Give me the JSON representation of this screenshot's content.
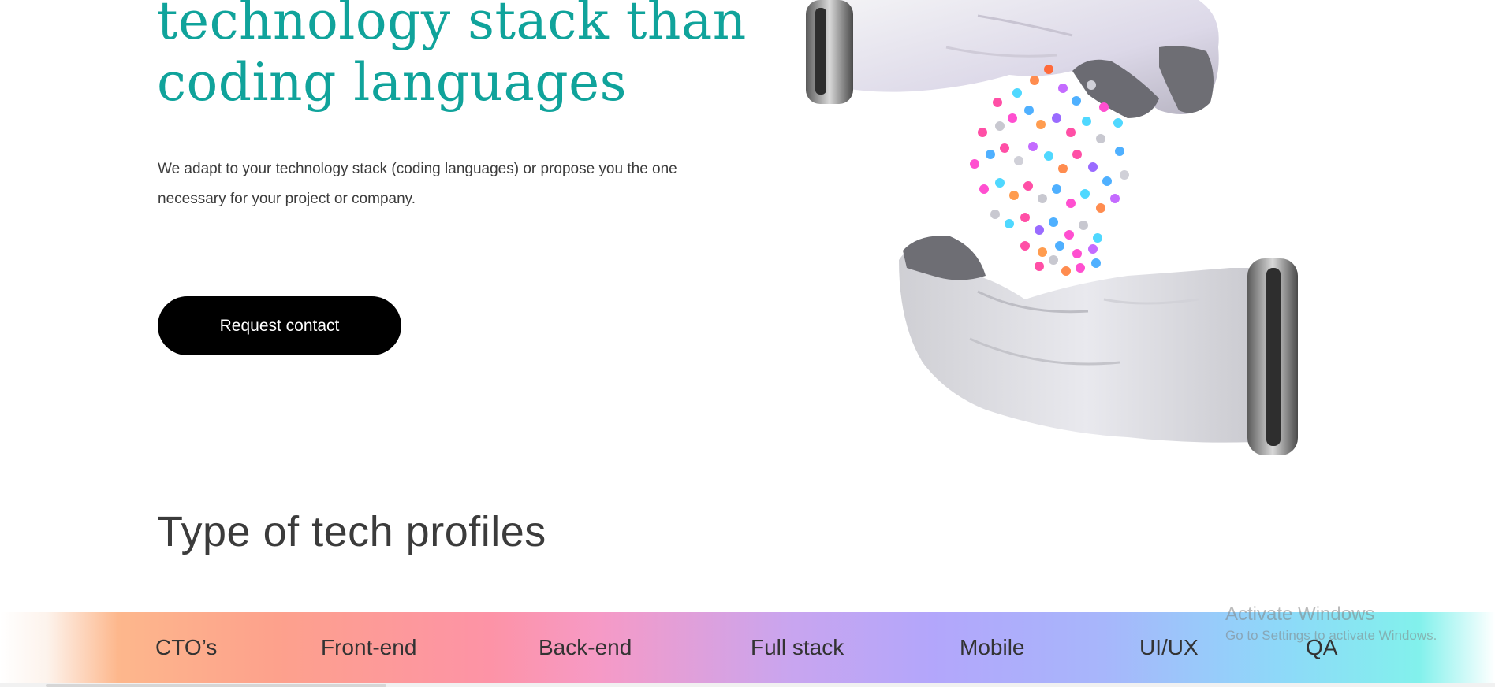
{
  "hero": {
    "title_line1": "technology stack than",
    "title_line2": "coding languages",
    "description": "We adapt to your technology stack (coding languages) or propose you the one necessary for your project or company.",
    "cta_label": "Request contact",
    "illustration": "astronaut-gloves-particles"
  },
  "profiles": {
    "title": "Type of tech profiles",
    "items": [
      {
        "label": "CTO’s"
      },
      {
        "label": "Front-end"
      },
      {
        "label": "Back-end"
      },
      {
        "label": "Full stack"
      },
      {
        "label": "Mobile"
      },
      {
        "label": "UI/UX"
      },
      {
        "label": "QA"
      }
    ]
  },
  "watermark": {
    "title": "Activate Windows",
    "subtitle": "Go to Settings to activate Windows."
  },
  "colors": {
    "accent": "#10a39b",
    "text": "#3b3b3b",
    "button": "#000000",
    "button_text": "#ffffff"
  }
}
